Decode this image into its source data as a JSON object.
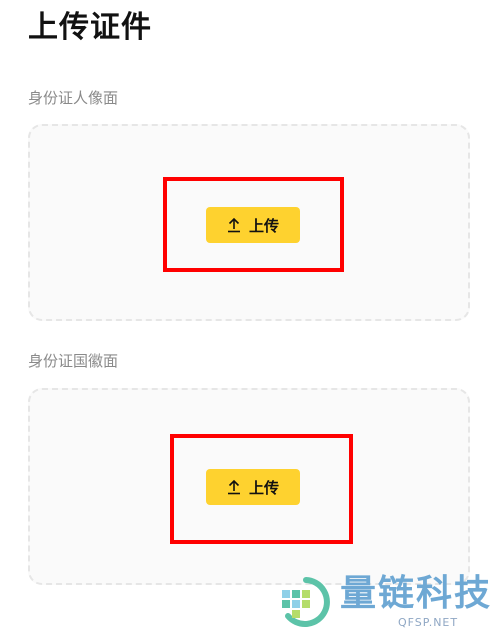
{
  "header": {
    "title": "上传证件"
  },
  "sections": [
    {
      "label": "身份证人像面",
      "upload_label": "上传"
    },
    {
      "label": "身份证国徽面",
      "upload_label": "上传"
    }
  ],
  "watermark": {
    "brand": "量链科技",
    "domain": "QFSP.NET"
  },
  "colors": {
    "button": "#fed22f",
    "highlight": "#ff0000",
    "label": "#8a8a8a",
    "zone_border": "#e6e6e6",
    "watermark": "#6ea8d4"
  },
  "icons": {
    "upload": "upload-arrow-icon"
  }
}
